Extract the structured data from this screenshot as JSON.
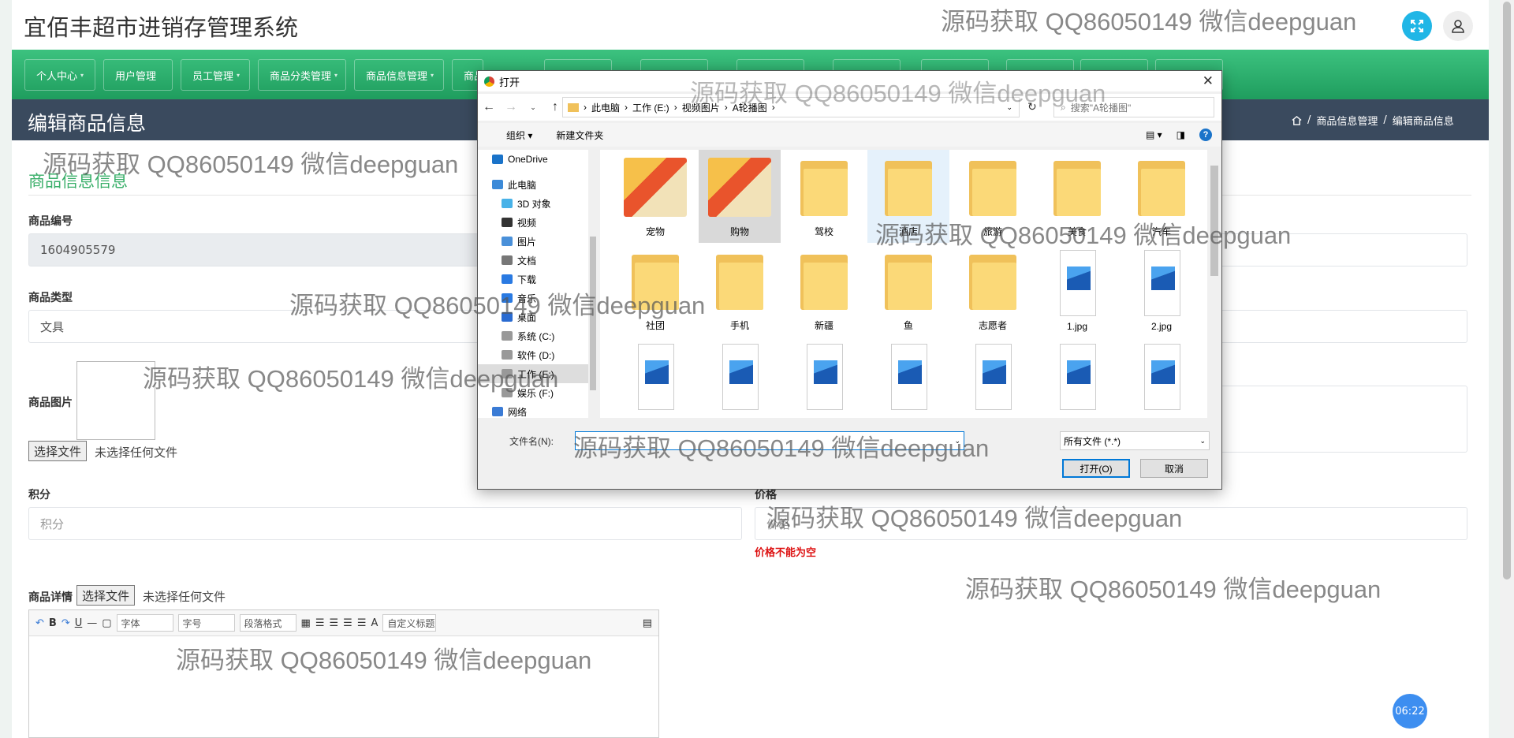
{
  "app": {
    "title": "宜佰丰超市进销存管理系统"
  },
  "nav": {
    "items": [
      {
        "label": "个人中心",
        "caret": true
      },
      {
        "label": "用户管理",
        "caret": false
      },
      {
        "label": "员工管理",
        "caret": true
      },
      {
        "label": "商品分类管理",
        "caret": true
      },
      {
        "label": "商品信息管理",
        "caret": true
      },
      {
        "label": "商品",
        "caret": false
      }
    ]
  },
  "page": {
    "title": "编辑商品信息",
    "breadcrumb": [
      "商品信息管理",
      "编辑商品信息"
    ]
  },
  "form": {
    "section_title": "商品信息信息",
    "code_label": "商品编号",
    "code_value": "1604905579",
    "type_label": "商品类型",
    "type_value": "文具",
    "image_label": "商品图片",
    "choose_file": "选择文件",
    "no_file": "未选择任何文件",
    "points_label": "积分",
    "points_placeholder": "积分",
    "price_label": "价格",
    "price_placeholder": "价格",
    "price_error": "价格不能为空",
    "detail_label": "商品详情"
  },
  "editor": {
    "font": "字体",
    "size": "字号",
    "para": "段落格式",
    "custom_title": "自定义标题"
  },
  "dialog": {
    "title": "打开",
    "address": [
      "此电脑",
      "工作 (E:)",
      "视频图片",
      "A轮播图"
    ],
    "search_placeholder": "搜索\"A轮播图\"",
    "organize": "组织",
    "new_folder": "新建文件夹",
    "tree": [
      {
        "label": "OneDrive",
        "icon": "cloud-icon"
      },
      {
        "label": "此电脑",
        "icon": "computer-icon"
      },
      {
        "label": "3D 对象",
        "icon": "cube-icon"
      },
      {
        "label": "视频",
        "icon": "video-icon"
      },
      {
        "label": "图片",
        "icon": "picture-icon"
      },
      {
        "label": "文档",
        "icon": "document-icon"
      },
      {
        "label": "下载",
        "icon": "download-icon"
      },
      {
        "label": "音乐",
        "icon": "music-icon"
      },
      {
        "label": "桌面",
        "icon": "desktop-icon"
      },
      {
        "label": "系统 (C:)",
        "icon": "drive-icon"
      },
      {
        "label": "软件 (D:)",
        "icon": "drive-icon"
      },
      {
        "label": "工作 (E:)",
        "icon": "drive-icon"
      },
      {
        "label": "娱乐 (F:)",
        "icon": "drive-icon"
      },
      {
        "label": "网络",
        "icon": "network-icon"
      }
    ],
    "files": [
      {
        "name": "宠物",
        "kind": "photo-folder"
      },
      {
        "name": "购物",
        "kind": "photo-folder"
      },
      {
        "name": "驾校",
        "kind": "folder"
      },
      {
        "name": "酒店",
        "kind": "folder"
      },
      {
        "name": "旅游",
        "kind": "folder"
      },
      {
        "name": "美食",
        "kind": "folder"
      },
      {
        "name": "汽车",
        "kind": "folder"
      },
      {
        "name": "社团",
        "kind": "folder"
      },
      {
        "name": "手机",
        "kind": "folder"
      },
      {
        "name": "新疆",
        "kind": "folder"
      },
      {
        "name": "鱼",
        "kind": "folder"
      },
      {
        "name": "志愿者",
        "kind": "folder"
      },
      {
        "name": "1.jpg",
        "kind": "image"
      },
      {
        "name": "2.jpg",
        "kind": "image"
      },
      {
        "name": "",
        "kind": "image"
      },
      {
        "name": "",
        "kind": "image"
      },
      {
        "name": "",
        "kind": "image"
      },
      {
        "name": "",
        "kind": "image"
      },
      {
        "name": "",
        "kind": "image"
      },
      {
        "name": "",
        "kind": "image"
      },
      {
        "name": "",
        "kind": "image"
      }
    ],
    "filename_label": "文件名(N):",
    "filetype": "所有文件 (*.*)",
    "open": "打开(O)",
    "cancel": "取消"
  },
  "clock": "06:22",
  "watermark": "源码获取 QQ86050149 微信deepguan"
}
